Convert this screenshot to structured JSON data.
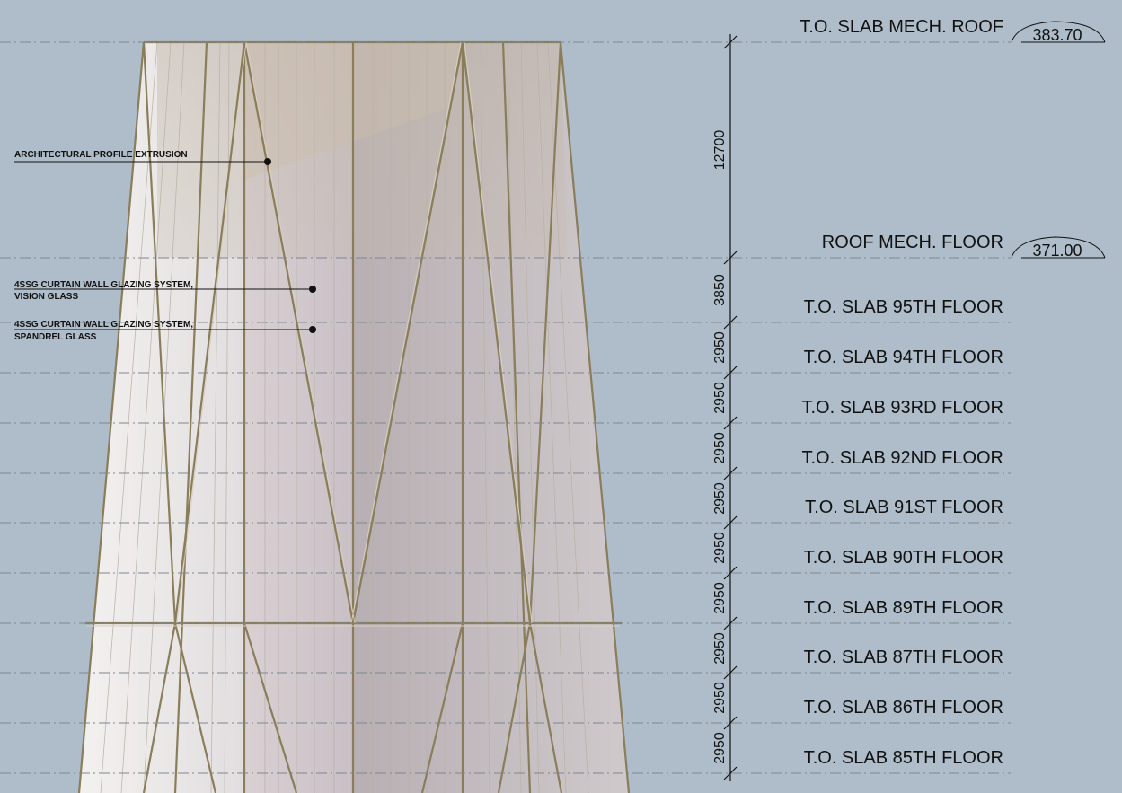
{
  "levels": [
    {
      "label": "T.O. SLAB MECH. ROOF",
      "elevation": "383.70"
    },
    {
      "label": "ROOF MECH. FLOOR",
      "elevation": "371.00"
    },
    {
      "label": "T.O. SLAB 95TH FLOOR"
    },
    {
      "label": "T.O. SLAB 94TH FLOOR"
    },
    {
      "label": "T.O. SLAB 93RD FLOOR"
    },
    {
      "label": "T.O. SLAB 92ND FLOOR"
    },
    {
      "label": "T.O. SLAB 91ST FLOOR"
    },
    {
      "label": "T.O. SLAB 90TH FLOOR"
    },
    {
      "label": "T.O. SLAB 89TH FLOOR"
    },
    {
      "label": "T.O. SLAB 87TH FLOOR"
    },
    {
      "label": "T.O. SLAB 86TH FLOOR"
    },
    {
      "label": "T.O. SLAB 85TH FLOOR"
    }
  ],
  "dimensions": [
    "12700",
    "3850",
    "2950",
    "2950",
    "2950",
    "2950",
    "2950",
    "2950",
    "2950",
    "2950",
    "2950"
  ],
  "annotations": [
    {
      "lines": [
        "ARCHITECTURAL PROFILE EXTRUSION"
      ]
    },
    {
      "lines": [
        "4SSG CURTAIN WALL GLAZING SYSTEM,",
        "VISION GLASS"
      ]
    },
    {
      "lines": [
        "4SSG CURTAIN WALL GLAZING SYSTEM,",
        "SPANDREL GLASS"
      ]
    }
  ],
  "colors": {
    "background": "#aebdc9",
    "frame": "#8a7d5a",
    "glass_light": "#eeeceb",
    "glass_mid": "#d4cbcf",
    "glass_dark": "#b5acb1",
    "level_line": "#7d8790"
  }
}
